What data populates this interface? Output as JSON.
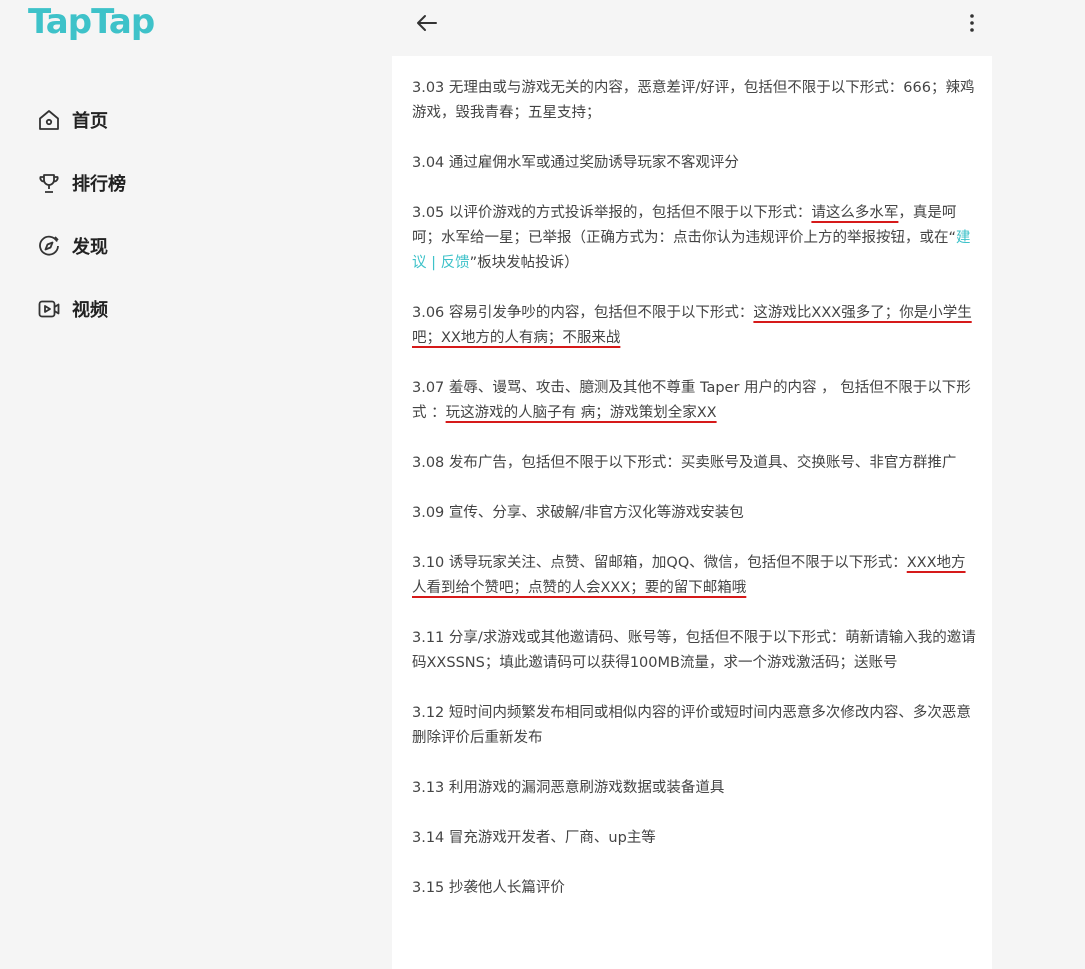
{
  "brand": {
    "logo_text": "TapTap",
    "accent": "#3ec2c9"
  },
  "sidebar": {
    "items": [
      {
        "label": "首页",
        "icon": "home-icon"
      },
      {
        "label": "排行榜",
        "icon": "trophy-icon"
      },
      {
        "label": "发现",
        "icon": "compass-icon"
      },
      {
        "label": "视频",
        "icon": "video-icon"
      }
    ]
  },
  "topbar": {
    "back_icon": "arrow-left-icon",
    "more_icon": "more-vertical-icon"
  },
  "rules": [
    {
      "num": "3.03",
      "text": "无理由或与游戏无关的内容，恶意差评/好评，包括但不限于以下形式：666；辣鸡游戏，毁我青春；五星支持；"
    },
    {
      "num": "3.04",
      "text": "通过雇佣水军或通过奖励诱导玩家不客观评分"
    },
    {
      "num": "3.05",
      "pre": "以评价游戏的方式投诉举报的，包括但不限于以下形式：",
      "hl": "请这么多水军",
      "mid": "，真是呵呵；水军给一星；已举报（正确方式为：点击你认为违规评价上方的举报按钮，或在“",
      "link": "建议 | 反馈",
      "post": "”板块发帖投诉）"
    },
    {
      "num": "3.06",
      "pre": "容易引发争吵的内容，包括但不限于以下形式：",
      "hl": "这游戏比XXX强多了；你是小学生吧；XX地方的人有病；不服来战"
    },
    {
      "num": "3.07",
      "pre": "羞辱、谩骂、攻击、臆测及其他不尊重 Taper 用户的内容 ， 包括但不限于以下形式 ：",
      "hl": "玩这游戏的人脑子有 病；游戏策划全家XX"
    },
    {
      "num": "3.08",
      "text": "发布广告，包括但不限于以下形式：买卖账号及道具、交换账号、非官方群推广"
    },
    {
      "num": "3.09",
      "text": "宣传、分享、求破解/非官方汉化等游戏安装包"
    },
    {
      "num": "3.10",
      "pre": "诱导玩家关注、点赞、留邮箱，加QQ、微信，包括但不限于以下形式：",
      "hl": "XXX地方人看到给个赞吧；点赞的人会XXX；要的留下邮箱哦"
    },
    {
      "num": "3.11",
      "text": "分享/求游戏或其他邀请码、账号等，包括但不限于以下形式：萌新请输入我的邀请码XXSSNS；填此邀请码可以获得100MB流量，求一个游戏激活码；送账号"
    },
    {
      "num": "3.12",
      "text": "短时间内频繁发布相同或相似内容的评价或短时间内恶意多次修改内容、多次恶意删除评价后重新发布"
    },
    {
      "num": "3.13",
      "text": "利用游戏的漏洞恶意刷游戏数据或装备道具"
    },
    {
      "num": "3.14",
      "text": "冒充游戏开发者、厂商、up主等"
    },
    {
      "num": "3.15",
      "text": "抄袭他人长篇评价"
    }
  ]
}
